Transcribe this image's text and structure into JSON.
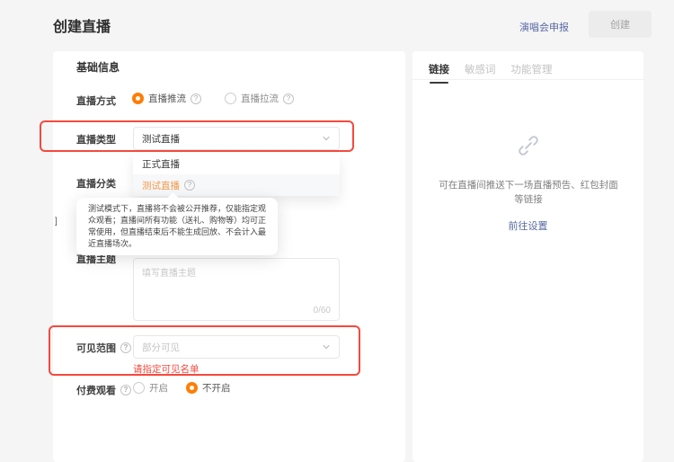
{
  "header": {
    "title": "创建直播",
    "concert_link": "演唱会申报",
    "create_button": "创建"
  },
  "basic_info": {
    "section_title": "基础信息",
    "stream_method": {
      "label": "直播方式",
      "options": [
        {
          "label": "直播推流",
          "selected": true
        },
        {
          "label": "直播拉流",
          "selected": false
        }
      ]
    },
    "stream_type": {
      "label": "直播类型",
      "value": "测试直播",
      "options": [
        {
          "label": "正式直播",
          "selected": false
        },
        {
          "label": "测试直播",
          "selected": true
        }
      ]
    },
    "stream_category": {
      "label": "直播分类"
    },
    "obscured_fragment": "]",
    "test_mode_tooltip": "测试模式下，直播将不会被公开推荐，仅能指定观众观看；直播间所有功能（送礼、购物等）均可正常使用，但直播结束后不能生成回放、不会计入最近直播场次。",
    "stream_topic": {
      "label": "直播主题",
      "placeholder": "填写直播主题",
      "counter": "0/60"
    },
    "visibility": {
      "label": "可见范围",
      "value": "部分可见",
      "error": "请指定可见名单"
    },
    "paid_view": {
      "label": "付费观看",
      "options": [
        {
          "label": "开启",
          "selected": false
        },
        {
          "label": "不开启",
          "selected": true
        }
      ]
    }
  },
  "link_panel": {
    "tabs": [
      {
        "label": "链接",
        "active": true
      },
      {
        "label": "敏感词",
        "active": false
      },
      {
        "label": "功能管理",
        "active": false
      }
    ],
    "empty_description": "可在直播间推送下一场直播预告、红包封面等链接",
    "settings_link": "前往设置"
  },
  "colors": {
    "accent_orange": "#ff7d00",
    "dropdown_selected_orange": "#f2994a",
    "annotation_red": "#f5493d",
    "error_red": "#f5483b",
    "link_blue": "#5868a0"
  }
}
